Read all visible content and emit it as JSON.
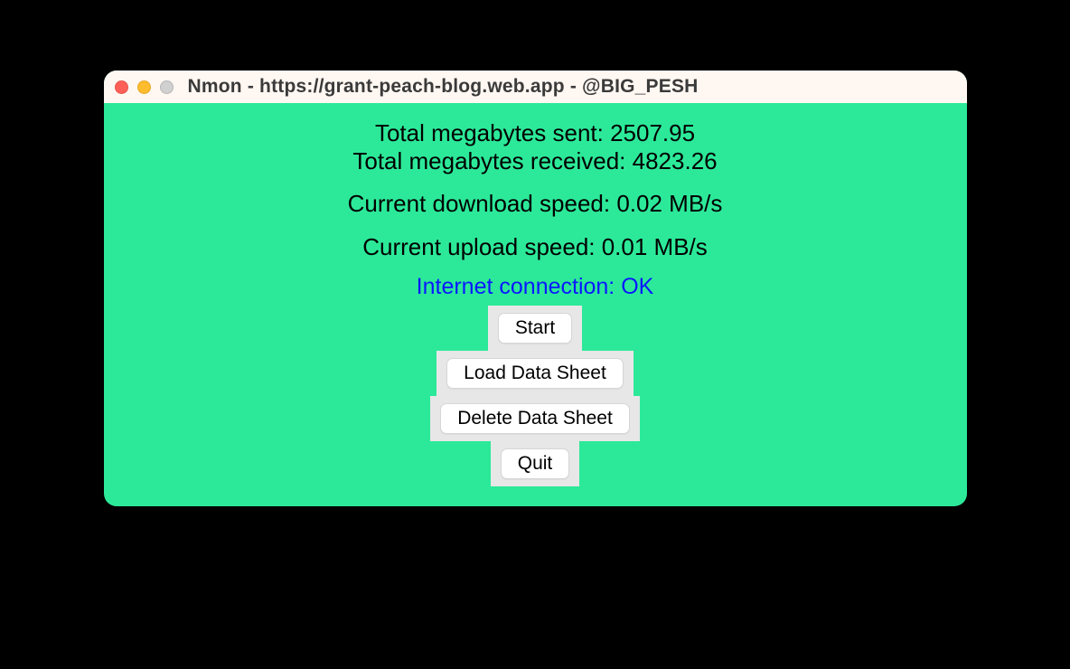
{
  "window": {
    "title": "Nmon - https://grant-peach-blog.web.app - @BIG_PESH"
  },
  "stats": {
    "sent": "Total megabytes sent: 2507.95",
    "received": "Total megabytes received: 4823.26",
    "download": "Current download speed: 0.02 MB/s",
    "upload": "Current upload speed: 0.01 MB/s",
    "connection": "Internet connection: OK"
  },
  "buttons": {
    "start": "Start",
    "load": "Load Data Sheet",
    "delete": "Delete Data Sheet",
    "quit": "Quit"
  }
}
